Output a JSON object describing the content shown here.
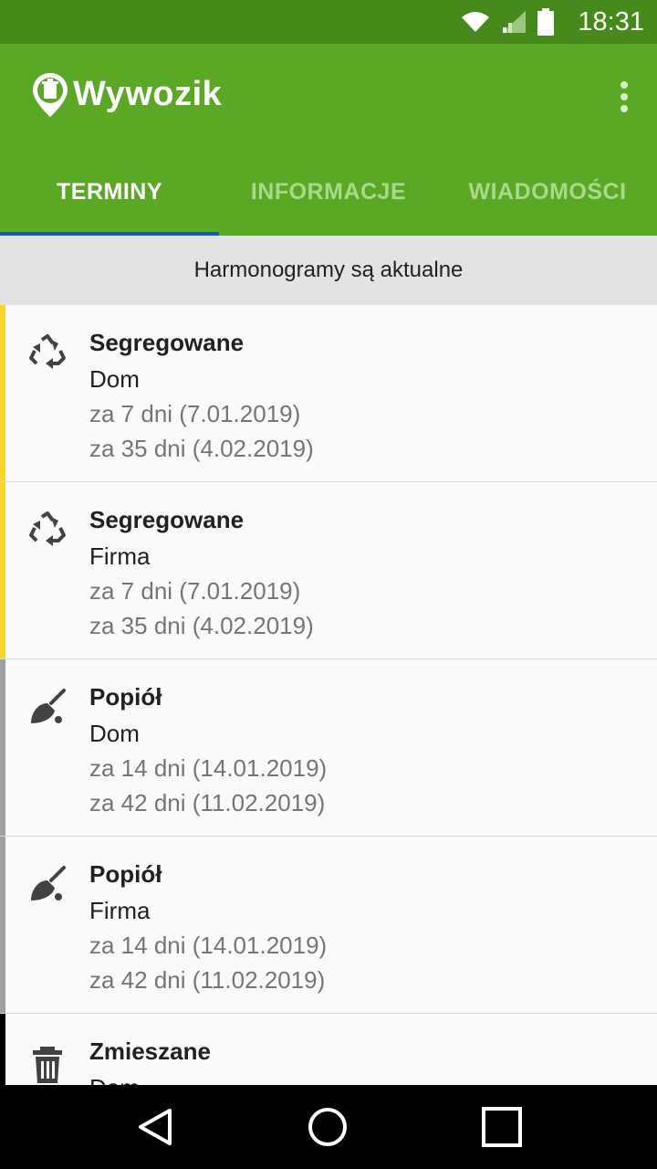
{
  "status_bar": {
    "time": "18:31",
    "icons": [
      "wifi-icon",
      "signal-icon",
      "battery-icon"
    ]
  },
  "app": {
    "title": "Wywozik"
  },
  "tabs": [
    {
      "label": "TERMINY",
      "active": true
    },
    {
      "label": "INFORMACJE",
      "active": false
    },
    {
      "label": "WIADOMOŚCI",
      "active": false
    }
  ],
  "banner": {
    "text": "Harmonogramy są aktualne"
  },
  "items": [
    {
      "icon": "recycle-icon",
      "color": "#f6d62a",
      "name": "Segregowane",
      "place": "Dom",
      "date1": "za 7 dni (7.01.2019)",
      "date2": "za 35 dni (4.02.2019)"
    },
    {
      "icon": "recycle-icon",
      "color": "#f6d62a",
      "name": "Segregowane",
      "place": "Firma",
      "date1": "za 7 dni (7.01.2019)",
      "date2": "za 35 dni (4.02.2019)"
    },
    {
      "icon": "broom-icon",
      "color": "#9e9e9e",
      "name": "Popiół",
      "place": "Dom",
      "date1": "za 14 dni (14.01.2019)",
      "date2": "za 42 dni (11.02.2019)"
    },
    {
      "icon": "broom-icon",
      "color": "#9e9e9e",
      "name": "Popiół",
      "place": "Firma",
      "date1": "za 14 dni (14.01.2019)",
      "date2": "za 42 dni (11.02.2019)"
    },
    {
      "icon": "trash-icon",
      "color": "#000000",
      "name": "Zmieszane",
      "place": "Dom",
      "date1": "",
      "date2": ""
    }
  ],
  "colors": {
    "status_bar": "#468a1c",
    "app_bar": "#5aa823",
    "tab_indicator": "#1a5aa8",
    "tab_inactive": "#a9d98a"
  }
}
